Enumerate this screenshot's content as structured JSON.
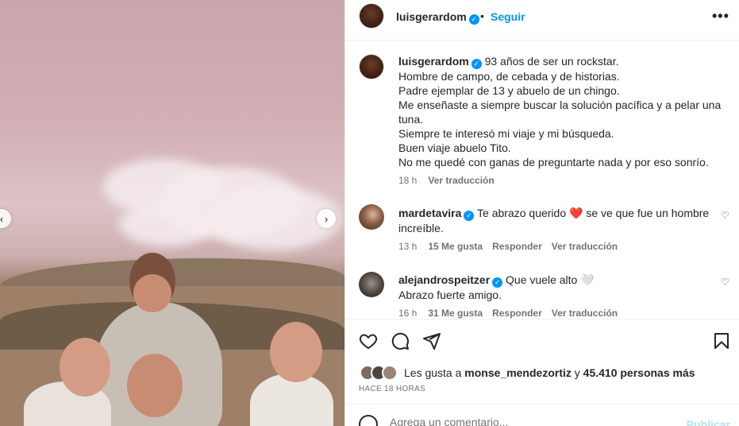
{
  "post": {
    "username": "luisgerardom",
    "follow_label": "Seguir",
    "more_label": "•••",
    "caption_lines": [
      "93 años de ser un rockstar.",
      "Hombre de campo, de cebada y de historias.",
      "Padre ejemplar de 13 y abuelo de un chingo.",
      "Me enseñaste a siempre buscar la solución pacífica y a pelar una",
      "tuna.",
      "Siempre te interesó mi viaje y mi búsqueda.",
      "Buen viaje abuelo Tito.",
      "No me quedé con ganas de preguntarte nada y por eso sonrío."
    ],
    "caption_time": "18 h",
    "see_translation": "Ver traducción",
    "slide_prev": "‹",
    "slide_next": "›"
  },
  "comments": [
    {
      "username": "mardetavira",
      "text_before": "Te abrazo querido",
      "emoji": "❤️",
      "text_after": "se ve que fue un hombre",
      "text_line2": "increíble.",
      "time": "13 h",
      "likes": "15 Me gusta",
      "reply": "Responder",
      "translate": "Ver traducción"
    },
    {
      "username": "alejandrospeitzer",
      "text_before": "Que vuele alto",
      "emoji": "🤍",
      "text_line2": "Abrazo fuerte amigo.",
      "time": "16 h",
      "likes": "31 Me gusta",
      "reply": "Responder",
      "translate": "Ver traducción"
    }
  ],
  "likes": {
    "prefix": "Les gusta a",
    "user": "monse_mendezortiz",
    "connector": "y",
    "count": "45.410 personas más"
  },
  "time_ago": "HACE 18 HORAS",
  "add_comment": {
    "placeholder": "Agrega un comentario...",
    "publish": "Publicar"
  },
  "colors": {
    "accent": "#0095f6",
    "text": "#262626",
    "muted": "#737373",
    "heart": "#e0245e"
  },
  "icons": [
    "heart-icon",
    "comment-icon",
    "share-icon",
    "save-icon",
    "emoji-icon",
    "verified-icon"
  ]
}
